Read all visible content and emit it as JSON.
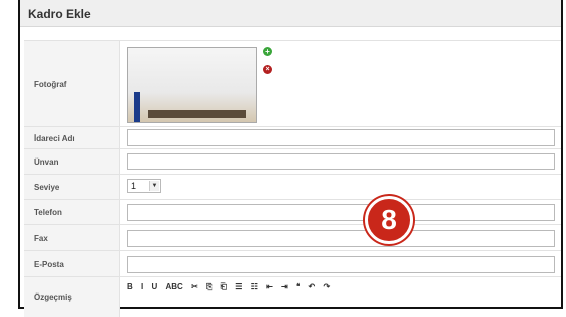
{
  "header": {
    "title": "Kadro Ekle"
  },
  "form": {
    "photo_label": "Fotoğraf",
    "name_label": "İdareci Adı",
    "title_label": "Ünvan",
    "level_label": "Seviye",
    "level_value": "1",
    "phone_label": "Telefon",
    "fax_label": "Fax",
    "email_label": "E-Posta",
    "bio_label": "Özgeçmiş"
  },
  "toolbar": {
    "items": [
      "B",
      "I",
      "U",
      "ABC",
      "✂",
      "⎘",
      "⎗",
      "☰",
      "☷",
      "⇤",
      "⇥",
      "❝",
      "↶",
      "↷"
    ]
  },
  "badge": {
    "number": "8"
  },
  "icons": {
    "add": "plus-icon",
    "remove": "close-icon"
  }
}
